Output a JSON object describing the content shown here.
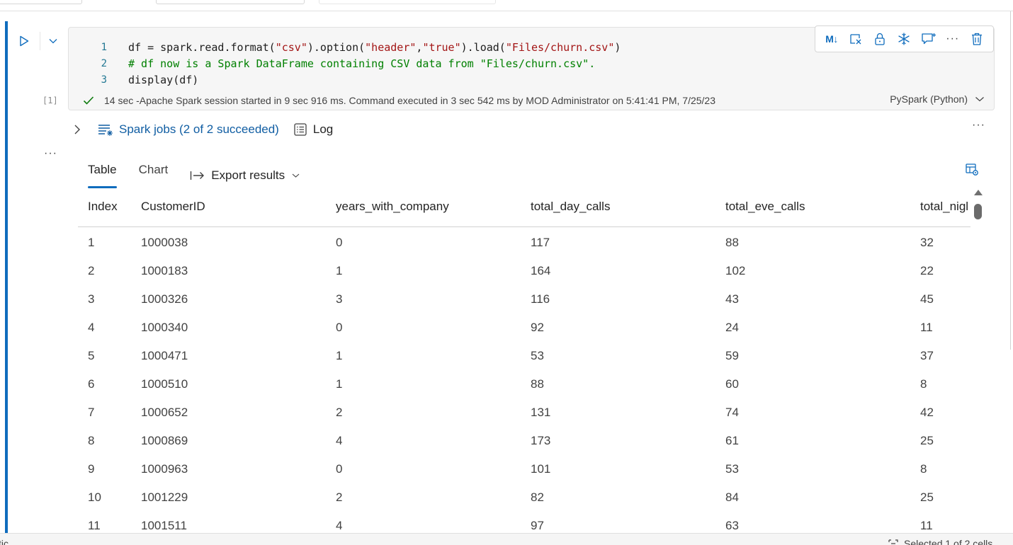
{
  "cell": {
    "execution_count": "[1]",
    "code_lines": [
      {
        "num": "1",
        "parts": [
          {
            "t": "df = spark.read.format(",
            "k": "p"
          },
          {
            "t": "\"csv\"",
            "k": "s"
          },
          {
            "t": ").option(",
            "k": "p"
          },
          {
            "t": "\"header\"",
            "k": "s"
          },
          {
            "t": ",",
            "k": "p"
          },
          {
            "t": "\"true\"",
            "k": "s"
          },
          {
            "t": ").load(",
            "k": "p"
          },
          {
            "t": "\"Files/churn.csv\"",
            "k": "s"
          },
          {
            "t": ")",
            "k": "p"
          }
        ]
      },
      {
        "num": "2",
        "parts": [
          {
            "t": "# df now is a Spark DataFrame containing CSV data from \"Files/churn.csv\".",
            "k": "c"
          }
        ]
      },
      {
        "num": "3",
        "parts": [
          {
            "t": "display(df)",
            "k": "p"
          }
        ]
      }
    ],
    "toolbar": {
      "markdown_label": "M↓",
      "more_label": "···"
    },
    "status": {
      "text": "14 sec -Apache Spark session started in 9 sec 916 ms. Command executed in 3 sec 542 ms by MOD Administrator on 5:41:41 PM, 7/25/23",
      "language": "PySpark (Python)"
    }
  },
  "output": {
    "spark_jobs_label": "Spark jobs (2 of 2 succeeded)",
    "log_label": "Log",
    "more_label": "···",
    "tabs": [
      {
        "label": "Table",
        "active": true
      },
      {
        "label": "Chart",
        "active": false
      }
    ],
    "export_label": "Export results",
    "table": {
      "columns": [
        "Index",
        "CustomerID",
        "years_with_company",
        "total_day_calls",
        "total_eve_calls",
        "total_nigl"
      ],
      "rows": [
        [
          "1",
          "1000038",
          "0",
          "117",
          "88",
          "32"
        ],
        [
          "2",
          "1000183",
          "1",
          "164",
          "102",
          "22"
        ],
        [
          "3",
          "1000326",
          "3",
          "116",
          "43",
          "45"
        ],
        [
          "4",
          "1000340",
          "0",
          "92",
          "24",
          "11"
        ],
        [
          "5",
          "1000471",
          "1",
          "53",
          "59",
          "37"
        ],
        [
          "6",
          "1000510",
          "1",
          "88",
          "60",
          "8"
        ],
        [
          "7",
          "1000652",
          "2",
          "131",
          "74",
          "42"
        ],
        [
          "8",
          "1000869",
          "4",
          "173",
          "61",
          "25"
        ],
        [
          "9",
          "1000963",
          "0",
          "101",
          "53",
          "8"
        ],
        [
          "10",
          "1001229",
          "2",
          "82",
          "84",
          "25"
        ],
        [
          "11",
          "1001511",
          "4",
          "97",
          "63",
          "11"
        ]
      ]
    }
  },
  "bottom": {
    "left_fragment": "tic",
    "selection_text": "Selected 1 of 2 cells"
  },
  "colors": {
    "accent": "#0f6cbd",
    "link": "#115ea3",
    "success": "#107c10",
    "code_string": "#a31515",
    "code_comment": "#008000",
    "line_number": "#237893"
  }
}
